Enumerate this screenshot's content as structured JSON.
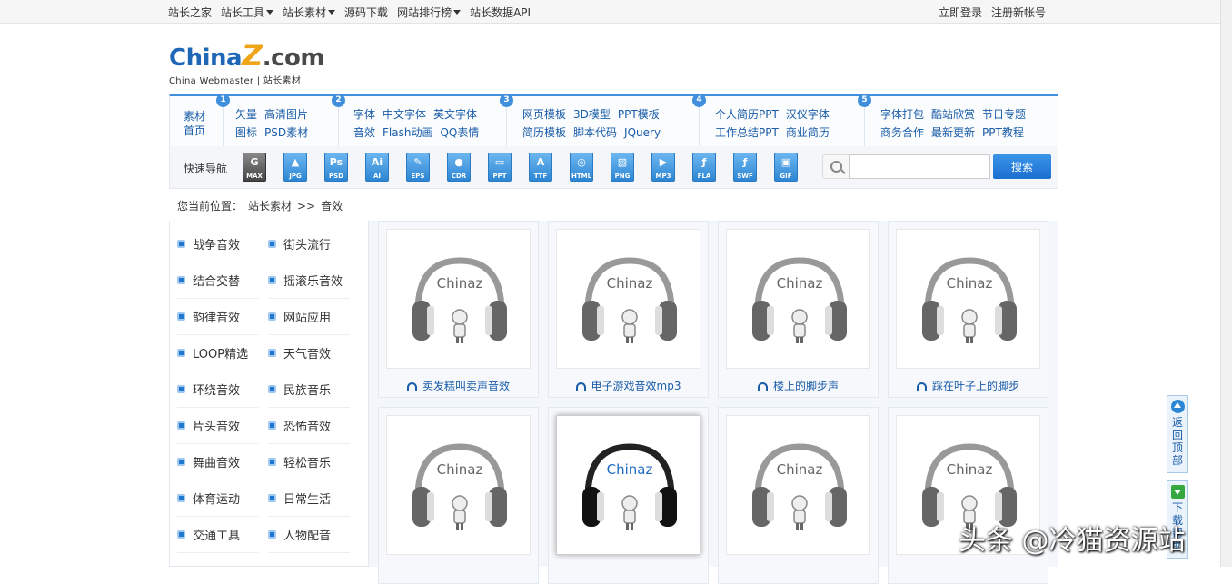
{
  "topbar": {
    "left": [
      {
        "label": "站长之家",
        "dropdown": false
      },
      {
        "label": "站长工具",
        "dropdown": true
      },
      {
        "label": "站长素材",
        "dropdown": true
      },
      {
        "label": "源码下载",
        "dropdown": false
      },
      {
        "label": "网站排行榜",
        "dropdown": true
      },
      {
        "label": "站长数据API",
        "dropdown": false
      }
    ],
    "login": "立即登录",
    "register": "注册新帐号"
  },
  "logo": {
    "brand_a": "China",
    "brand_z": "Z",
    "brand_com": ".com",
    "sub": "China Webmaster  |  站长素材"
  },
  "catnav": {
    "home": "素材首页",
    "groups": [
      {
        "num": "1",
        "rows": [
          [
            "矢量",
            "高清图片"
          ],
          [
            "图标",
            "PSD素材"
          ]
        ]
      },
      {
        "num": "2",
        "rows": [
          [
            "字体",
            "中文字体",
            "英文字体"
          ],
          [
            "音效",
            "Flash动画",
            "QQ表情"
          ]
        ]
      },
      {
        "num": "3",
        "rows": [
          [
            "网页模板",
            "3D模型",
            "PPT模板"
          ],
          [
            "简历模板",
            "脚本代码",
            "JQuery"
          ]
        ]
      },
      {
        "num": "4",
        "rows": [
          [
            "个人简历PPT",
            "汉仪字体"
          ],
          [
            "工作总结PPT",
            "商业简历"
          ]
        ]
      },
      {
        "num": "5",
        "rows": [
          [
            "字体打包",
            "酷站欣赏",
            "节日专题"
          ],
          [
            "商务合作",
            "最新更新",
            "PPT教程"
          ]
        ]
      }
    ]
  },
  "quicknav": {
    "label": "快速导航",
    "icons": [
      {
        "name": "max",
        "label": "MAX",
        "glyph": "G"
      },
      {
        "name": "jpg",
        "label": "JPG",
        "glyph": "▲"
      },
      {
        "name": "psd",
        "label": "PSD",
        "glyph": "Ps"
      },
      {
        "name": "ai",
        "label": "AI",
        "glyph": "Ai"
      },
      {
        "name": "eps",
        "label": "EPS",
        "glyph": "✎"
      },
      {
        "name": "cdr",
        "label": "CDR",
        "glyph": "●"
      },
      {
        "name": "ppt",
        "label": "PPT",
        "glyph": "▭"
      },
      {
        "name": "ttf",
        "label": "TTF",
        "glyph": "A"
      },
      {
        "name": "html",
        "label": "HTML",
        "glyph": "◎"
      },
      {
        "name": "png",
        "label": "PNG",
        "glyph": "▧"
      },
      {
        "name": "mp3",
        "label": "MP3",
        "glyph": "▶"
      },
      {
        "name": "fla",
        "label": "FLA",
        "glyph": "ƒ"
      },
      {
        "name": "swf",
        "label": "SWF",
        "glyph": "ƒ"
      },
      {
        "name": "gif",
        "label": "GIF",
        "glyph": "▣"
      }
    ],
    "search_placeholder": "",
    "search_button": "搜索"
  },
  "breadcrumb": {
    "prefix": "您当前位置：",
    "level1": "站长素材",
    "arrow": ">>",
    "level2": "音效"
  },
  "sidebar": {
    "items": [
      [
        "战争音效",
        "街头流行"
      ],
      [
        "结合交替",
        "摇滚乐音效"
      ],
      [
        "韵律音效",
        "网站应用"
      ],
      [
        "LOOP精选",
        "天气音效"
      ],
      [
        "环绕音效",
        "民族音乐"
      ],
      [
        "片头音效",
        "恐怖音效"
      ],
      [
        "舞曲音效",
        "轻松音乐"
      ],
      [
        "体育运动",
        "日常生活"
      ],
      [
        "交通工具",
        "人物配音"
      ]
    ]
  },
  "grid": {
    "thumb_text": "Chinaz",
    "cards": [
      {
        "title": "卖发糕叫卖声音效",
        "highlight": false
      },
      {
        "title": "电子游戏音效mp3",
        "highlight": false
      },
      {
        "title": "楼上的脚步声",
        "highlight": false
      },
      {
        "title": "踩在叶子上的脚步",
        "highlight": false
      },
      {
        "title": "",
        "highlight": false
      },
      {
        "title": "",
        "highlight": true
      },
      {
        "title": "",
        "highlight": false
      },
      {
        "title": "",
        "highlight": false
      }
    ]
  },
  "float": {
    "back_top": "返回顶部",
    "download": "下载帮助"
  },
  "watermark": "头条 @冷猫资源站"
}
